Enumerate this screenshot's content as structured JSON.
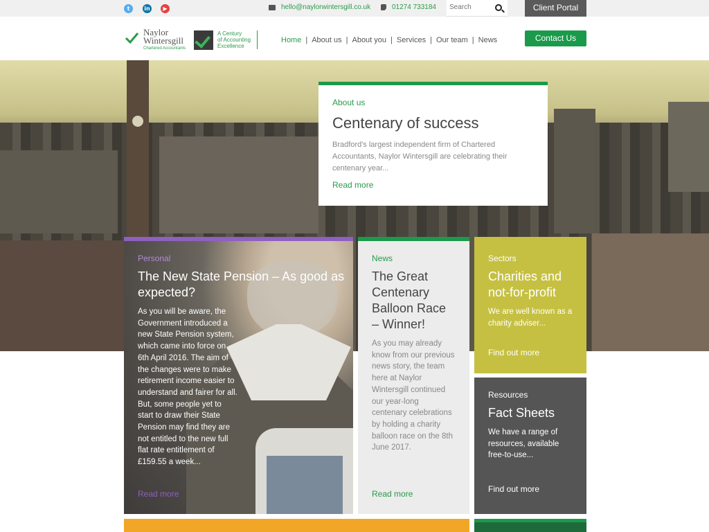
{
  "topbar": {
    "social": [
      {
        "name": "twitter-icon",
        "glyph": "t",
        "color": "#55acee"
      },
      {
        "name": "linkedin-icon",
        "glyph": "in",
        "color": "#0e76a8"
      },
      {
        "name": "youtube-icon",
        "glyph": "▶",
        "color": "#e5423f"
      }
    ],
    "email": "hello@naylorwintersgill.co.uk",
    "phone": "01274 733184",
    "search_placeholder": "Search",
    "client_portal": "Client Portal"
  },
  "header": {
    "logo_name_1": "Naylor",
    "logo_name_2": "Wintersgill",
    "logo_sub": "Chartered Accountants",
    "century_1": "A Century",
    "century_2": "of Accounting",
    "century_3": "Excellence",
    "nav": [
      "Home",
      "About us",
      "About you",
      "Services",
      "Our team",
      "News"
    ],
    "contact_button": "Contact Us"
  },
  "hero_card": {
    "kicker": "About us",
    "title": "Centenary of success",
    "body": "Bradford's largest independent firm of Chartered Accountants, Naylor Wintersgill are celebrating their centenary year...",
    "link": "Read more"
  },
  "tiles": {
    "personal": {
      "kicker": "Personal",
      "title": "The New State Pension – As good as expected?",
      "body": "As you will be aware, the Government introduced a new State Pension system, which came into force on 6th April 2016. The aim of the changes were to make retirement income easier to understand and fairer for all. But, some people yet to start to draw their State Pension may find they are not entitled to the new full flat rate entitlement of £159.55 a week...",
      "link": "Read more"
    },
    "news": {
      "kicker": "News",
      "title": "The Great Centenary Balloon Race – Winner!",
      "body": "As you may already know from our previous news story, the team here at Naylor Wintersgill continued our year-long centenary celebrations by holding a charity balloon race on the 8th June 2017.",
      "link": "Read more"
    },
    "sectors": {
      "kicker": "Sectors",
      "title": "Charities and not-for-profit",
      "body": "We are well known as a charity adviser...",
      "link": "Find out more"
    },
    "resources": {
      "kicker": "Resources",
      "title": "Fact Sheets",
      "body": "We have a range of resources, available free-to-use...",
      "link": "Find out more"
    }
  },
  "colors": {
    "brand_green": "#1a9a4a",
    "personal_purple": "#8f5fc2",
    "sectors_olive": "#c6c042",
    "resources_grey": "#555555"
  }
}
